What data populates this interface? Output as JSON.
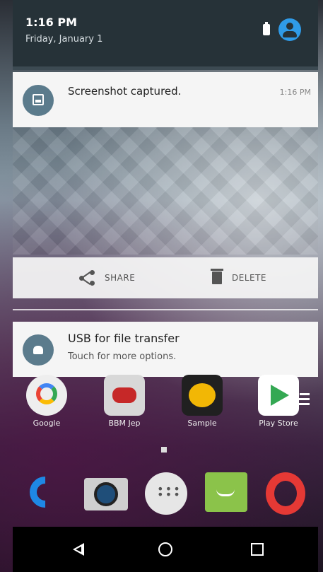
{
  "status": {
    "time": "1:16 PM",
    "date": "Friday, January 1"
  },
  "notifications": [
    {
      "icon": "image-icon",
      "title": "Screenshot captured.",
      "time": "1:16 PM",
      "actions": [
        {
          "label": "SHARE",
          "icon": "share-icon"
        },
        {
          "label": "DELETE",
          "icon": "trash-icon"
        }
      ]
    },
    {
      "icon": "android-icon",
      "title": "USB for file transfer",
      "subtitle": "Touch for more options."
    }
  ],
  "home_apps": [
    {
      "label": "Google",
      "icon": "google-icon"
    },
    {
      "label": "BBM Jep",
      "icon": "bbm-icon"
    },
    {
      "label": "Sample",
      "icon": "hundred-icon"
    },
    {
      "label": "Play Store",
      "icon": "play-store-icon"
    }
  ],
  "dock": [
    {
      "name": "phone",
      "icon": "phone-icon"
    },
    {
      "name": "camera",
      "icon": "camera-icon"
    },
    {
      "name": "apps",
      "icon": "app-drawer-icon"
    },
    {
      "name": "messaging",
      "icon": "messaging-icon"
    },
    {
      "name": "opera",
      "icon": "opera-icon"
    }
  ],
  "navigation": [
    {
      "name": "back",
      "icon": "back-icon"
    },
    {
      "name": "home",
      "icon": "home-icon"
    },
    {
      "name": "recents",
      "icon": "recents-icon"
    }
  ],
  "colors": {
    "shade_header": "#263238",
    "notification_bg": "#f5f5f5",
    "notification_icon_bg": "#5b7b8c",
    "user_accent": "#2f9be8"
  }
}
